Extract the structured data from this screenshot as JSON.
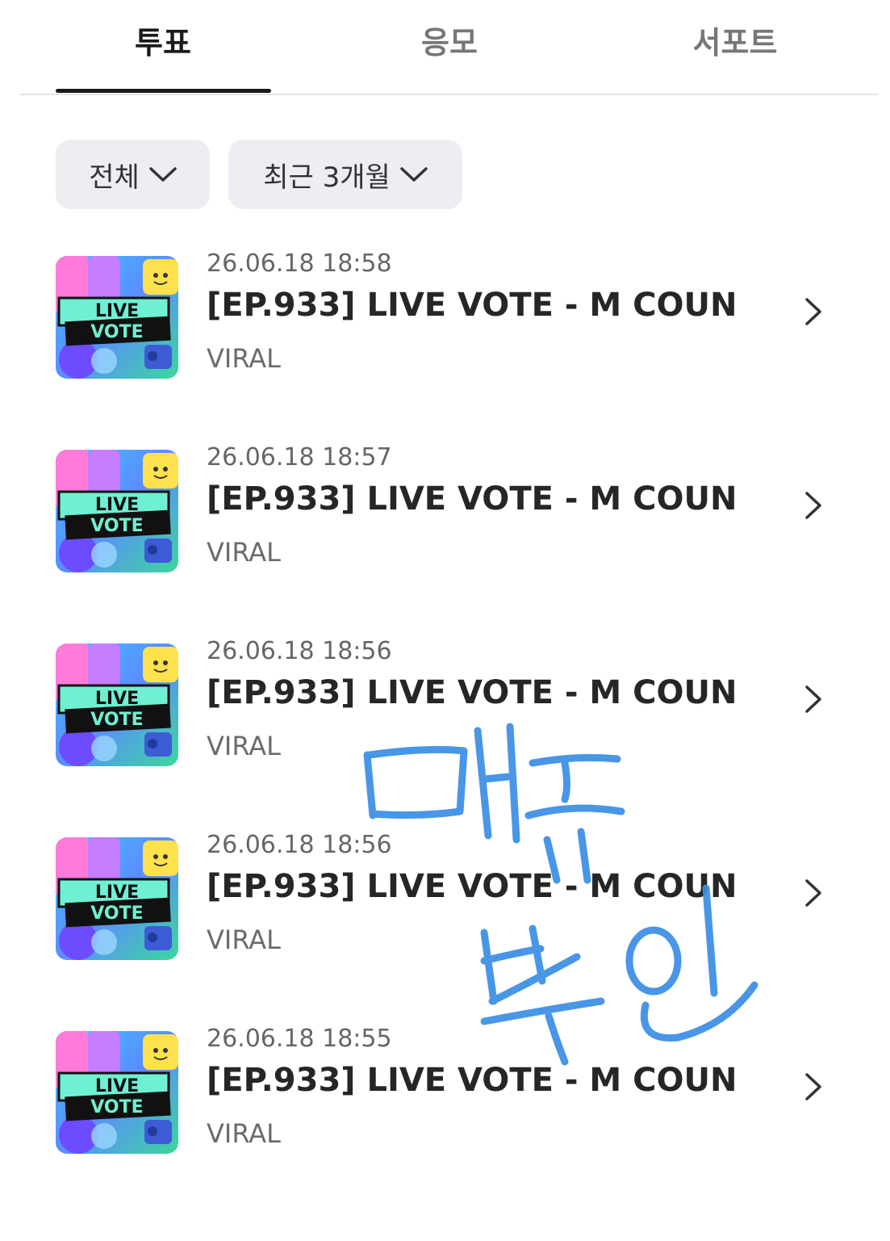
{
  "tabs": [
    {
      "label": "투표",
      "active": true
    },
    {
      "label": "응모",
      "active": false
    },
    {
      "label": "서포트",
      "active": false
    }
  ],
  "filters": {
    "category": "전체",
    "period": "최근 3개월"
  },
  "items": [
    {
      "date": "26.06.18 18:58",
      "title": "[EP.933] LIVE VOTE - M COUN...",
      "category": "VIRAL"
    },
    {
      "date": "26.06.18 18:57",
      "title": "[EP.933] LIVE VOTE - M COUN...",
      "category": "VIRAL"
    },
    {
      "date": "26.06.18 18:56",
      "title": "[EP.933] LIVE VOTE - M COUN...",
      "category": "VIRAL"
    },
    {
      "date": "26.06.18 18:56",
      "title": "[EP.933] LIVE VOTE - M COUN...",
      "category": "VIRAL"
    },
    {
      "date": "26.06.18 18:55",
      "title": "[EP.933] LIVE VOTE - M COUN...",
      "category": "VIRAL"
    }
  ],
  "thumbnail": {
    "line1": "LIVE",
    "line2": "VOTE"
  },
  "annotation": {
    "text": "매크 부인",
    "color": "#3a8ee6"
  },
  "colors": {
    "active_tab": "#1a1a1a",
    "filter_bg": "#eceef2"
  }
}
